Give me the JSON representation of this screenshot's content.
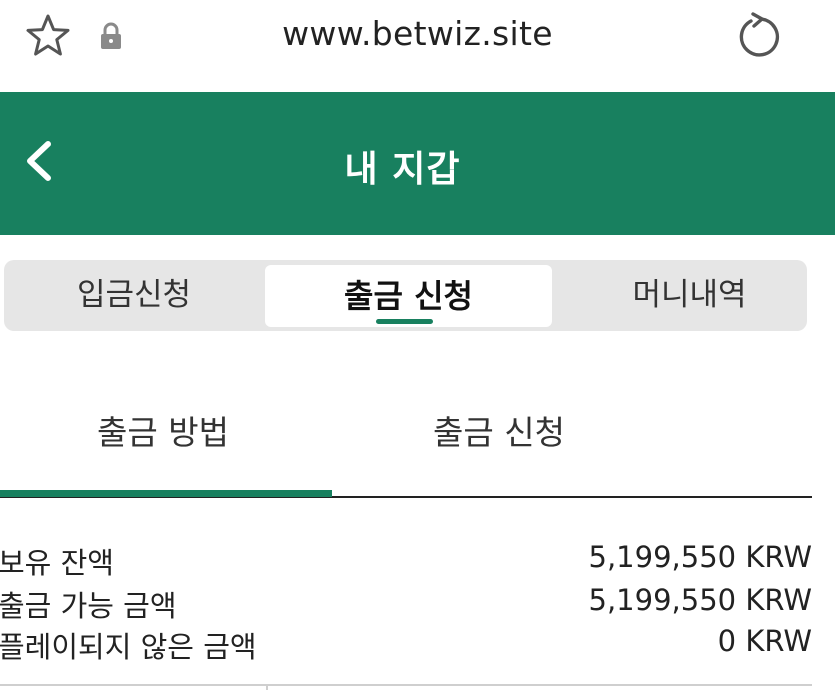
{
  "browser": {
    "url": "www.betwiz.site",
    "icons": [
      "star-icon",
      "lock-icon",
      "reload-icon"
    ]
  },
  "header": {
    "title": "내 지갑",
    "back_icon": "chevron-left-icon"
  },
  "segment_tabs": [
    {
      "label": "입금신청",
      "active": false
    },
    {
      "label": "출금 신청",
      "active": true
    },
    {
      "label": "머니내역",
      "active": false
    }
  ],
  "sub_tabs": [
    {
      "label": "출금 방법",
      "active": true
    },
    {
      "label": "출금 신청",
      "active": false
    }
  ],
  "balances": [
    {
      "label": "보유 잔액",
      "value": "5,199,550 KRW"
    },
    {
      "label": "출금 가능 금액",
      "value": "5,199,550 KRW"
    },
    {
      "label": "플레이되지 않은 금액",
      "value": "0 KRW"
    }
  ],
  "colors": {
    "brand": "#18805f",
    "segment_bg": "#e6e6e6"
  }
}
